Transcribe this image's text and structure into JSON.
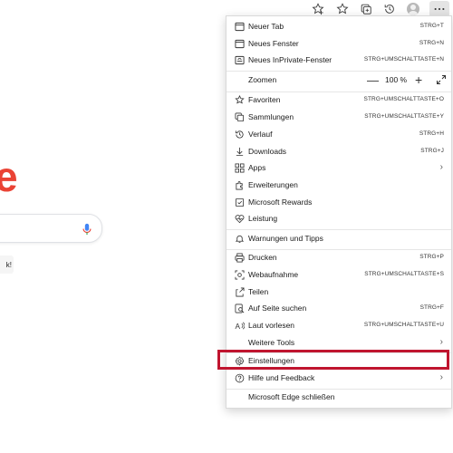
{
  "toolbar": {
    "icons": [
      "favorites-add-icon",
      "favorites-icon",
      "collections-icon",
      "history-icon",
      "profile-avatar",
      "more-icon"
    ]
  },
  "page": {
    "logo_fragment": "e",
    "button_fragment": "k!"
  },
  "menu": {
    "items": [
      {
        "label": "Neuer Tab",
        "shortcut": "STRG+T",
        "icon": "new-tab-icon"
      },
      {
        "label": "Neues Fenster",
        "shortcut": "STRG+N",
        "icon": "new-window-icon"
      },
      {
        "label": "Neues InPrivate-Fenster",
        "shortcut": "STRG+UMSCHALTTASTE+N",
        "icon": "inprivate-icon"
      },
      {
        "label": "Zoomen",
        "zoom_value": "100 %",
        "minus": "—",
        "plus": "+"
      },
      {
        "label": "Favoriten",
        "shortcut": "STRG+UMSCHALTTASTE+O",
        "icon": "favorites-star-icon"
      },
      {
        "label": "Sammlungen",
        "shortcut": "STRG+UMSCHALTTASTE+Y",
        "icon": "collections-icon"
      },
      {
        "label": "Verlauf",
        "shortcut": "STRG+H",
        "icon": "history-icon"
      },
      {
        "label": "Downloads",
        "shortcut": "STRG+J",
        "icon": "download-icon"
      },
      {
        "label": "Apps",
        "icon": "apps-icon"
      },
      {
        "label": "Erweiterungen",
        "icon": "extensions-icon"
      },
      {
        "label": "Microsoft Rewards",
        "icon": "rewards-icon"
      },
      {
        "label": "Leistung",
        "icon": "performance-icon"
      },
      {
        "label": "Warnungen und Tipps",
        "icon": "bell-icon"
      },
      {
        "label": "Drucken",
        "shortcut": "STRG+P",
        "icon": "printer-icon"
      },
      {
        "label": "Webaufnahme",
        "shortcut": "STRG+UMSCHALTTASTE+S",
        "icon": "web-capture-icon"
      },
      {
        "label": "Teilen",
        "icon": "share-icon"
      },
      {
        "label": "Auf Seite suchen",
        "shortcut": "STRG+F",
        "icon": "find-icon"
      },
      {
        "label": "Laut vorlesen",
        "shortcut": "STRG+UMSCHALTTASTE+U",
        "icon": "read-aloud-icon"
      },
      {
        "label": "Weitere Tools"
      },
      {
        "label": "Einstellungen",
        "icon": "settings-icon"
      },
      {
        "label": "Hilfe und Feedback",
        "icon": "help-icon"
      },
      {
        "label": "Microsoft Edge schließen"
      }
    ]
  },
  "colors": {
    "highlight": "#c0152f",
    "logo_red": "#ea4335",
    "mic_blue": "#4285f4"
  }
}
